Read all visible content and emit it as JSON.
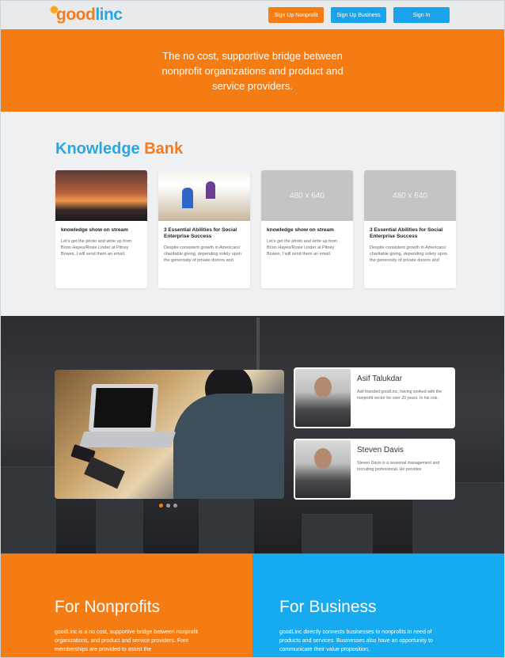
{
  "header": {
    "logo_left": "good",
    "logo_right": "linc",
    "signup_nonprofit": "Sign Up Nonprofit",
    "signup_business": "Sign Up Business",
    "signin": "Sign In"
  },
  "hero": {
    "tagline": "The no cost, supportive bridge between nonprofit organizations and product and service providers."
  },
  "knowledge_bank": {
    "title_part1": "Knowledge",
    "title_part2": "Bank",
    "cards": [
      {
        "image": "city-sunset",
        "title": "knowledge show on stream",
        "excerpt": "Let's get the photo and write up from Brion Hayes/Rosie Linder at Pitney Bowes, I will send them an email."
      },
      {
        "image": "office-workers",
        "title": "3 Essential Abilities for Social Enterprise Success",
        "excerpt": "Despite consistent growth in Americans' charitable giving, depending solely upon the generosity of private donors and"
      },
      {
        "image": "placeholder",
        "placeholder_text": "480 x 640",
        "title": "knowledge show on stream",
        "excerpt": "Let's get the photo and write up from Brion Hayes/Rosie Linder at Pitney Bowes, I will send them an email."
      },
      {
        "image": "placeholder",
        "placeholder_text": "480 x 640",
        "title": "3 Essential Abilities for Social Enterprise Success",
        "excerpt": "Despite consistent growth in Americans' charitable giving, depending solely upon the generosity of private donors and"
      }
    ]
  },
  "team": {
    "carousel": {
      "slides": 3,
      "active_index": 0
    },
    "people": [
      {
        "name": "Asif Talukdar",
        "bio": "Asif founded goodLinc, having worked with the nonprofit sector for over 20 years. In his role,"
      },
      {
        "name": "Steven Davis",
        "bio": "Steven Davis is a seasonal management and recruiting professional. He provides"
      }
    ]
  },
  "nonprofits": {
    "title": "For Nonprofits",
    "text": "goodLinc is a no cost, supportive bridge between nonprofit organizations, and product and service providers. Free memberships are provided to assist the"
  },
  "business": {
    "title": "For Business",
    "text": "goodLinc directly connects businesses to nonprofits in need of products and services. Businesses also have an opportunity to communicate their value proposition,"
  },
  "colors": {
    "orange": "#f57c12",
    "blue": "#16aaf0",
    "header_bg": "#e9eaeb"
  }
}
